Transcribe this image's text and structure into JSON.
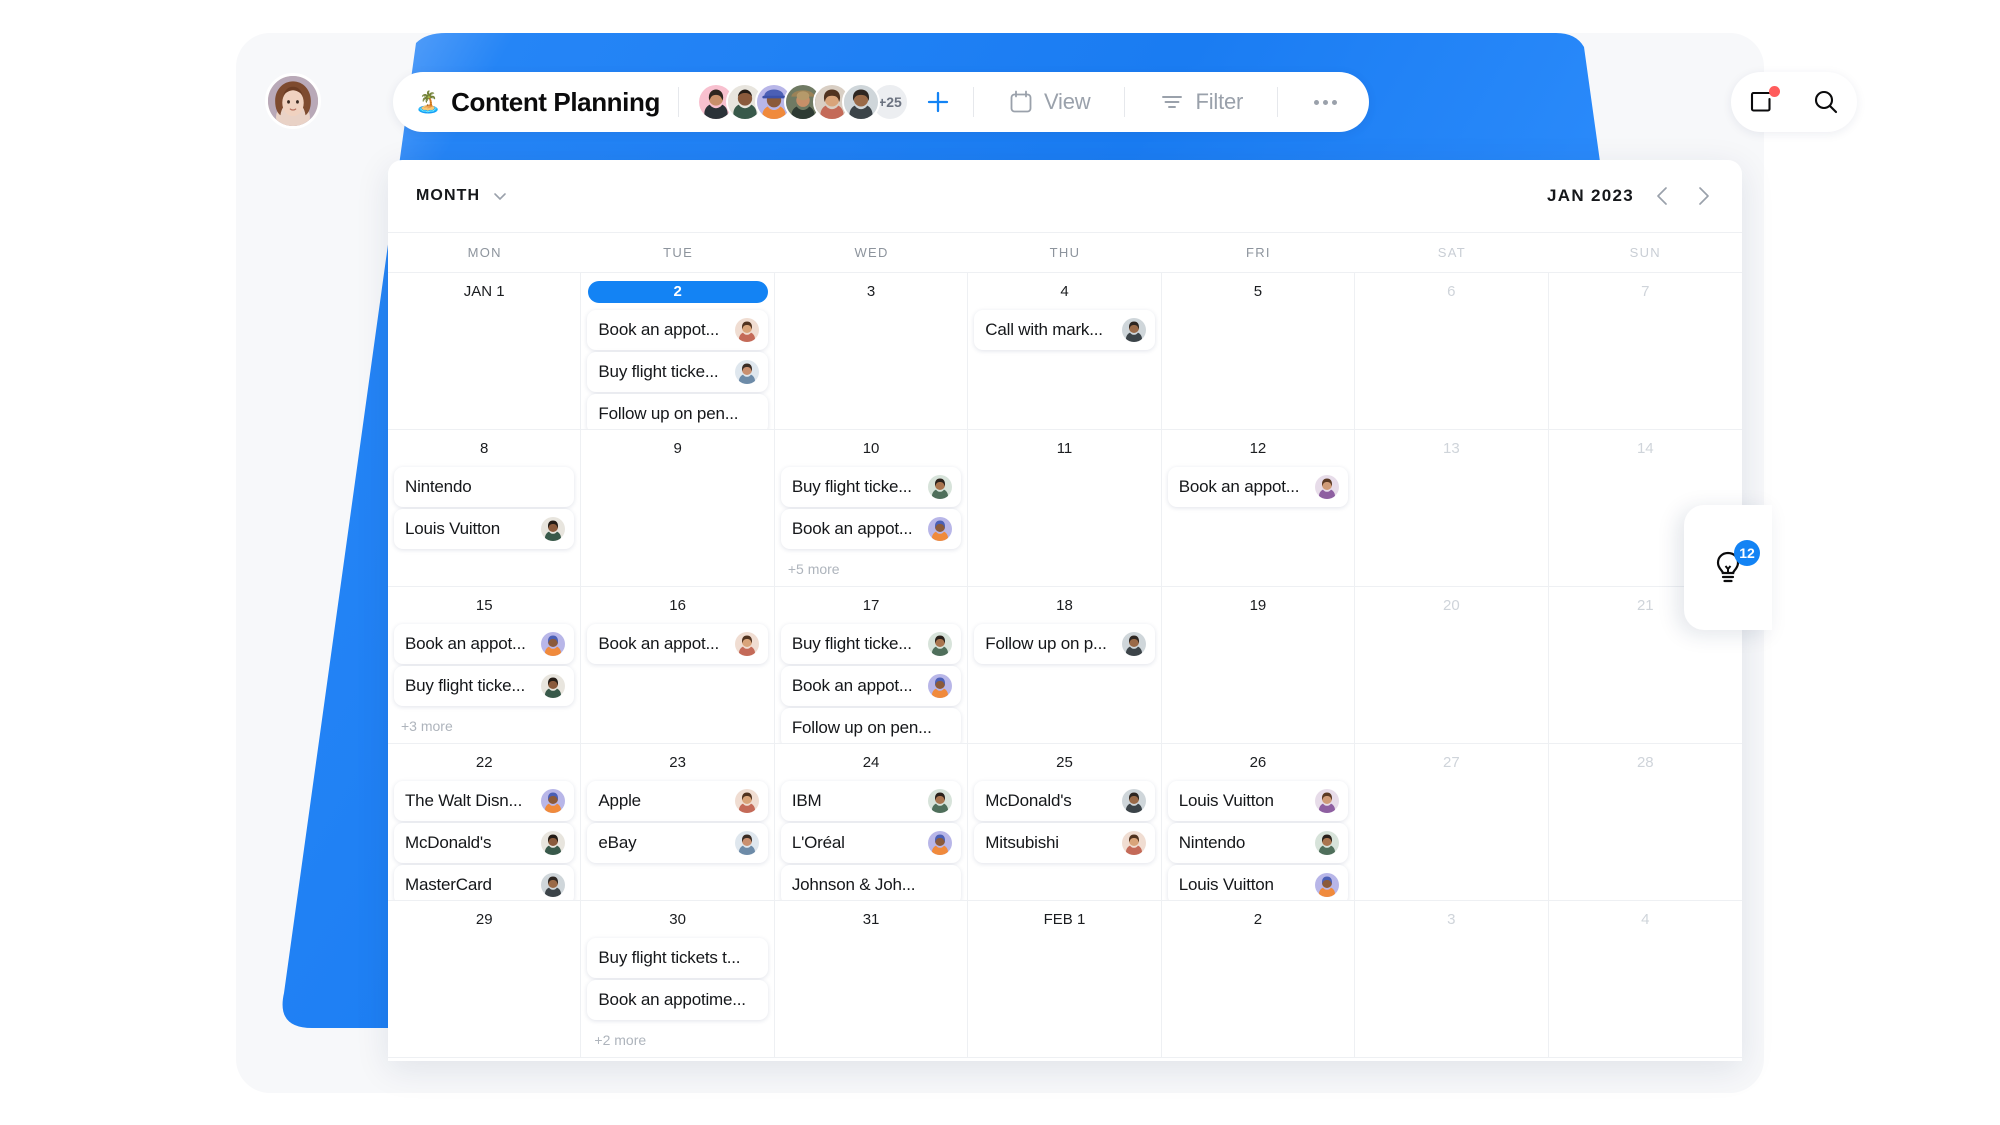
{
  "header": {
    "board_emoji": "🏝️",
    "board_title": "Content Planning",
    "members_overflow": "+25",
    "add_member_icon": "plus-icon",
    "view_label": "View",
    "filter_label": "Filter",
    "more_label": "...",
    "notifications_icon": "inbox-icon",
    "search_icon": "search-icon",
    "accent_color": "#1383f4",
    "notification_dot_color": "#ff5c5c"
  },
  "calendar": {
    "view_mode": "MONTH",
    "view_chevron_icon": "chevron-down-icon",
    "period": "JAN 2023",
    "prev_icon": "chevron-left-icon",
    "next_icon": "chevron-right-icon",
    "weekdays": [
      {
        "label": "MON",
        "dim": false
      },
      {
        "label": "TUE",
        "dim": false
      },
      {
        "label": "WED",
        "dim": false
      },
      {
        "label": "THU",
        "dim": false
      },
      {
        "label": "FRI",
        "dim": false
      },
      {
        "label": "SAT",
        "dim": true
      },
      {
        "label": "SUN",
        "dim": true
      }
    ],
    "days": [
      {
        "num": "JAN 1",
        "dim": false,
        "today": false,
        "events": [],
        "more": ""
      },
      {
        "num": "2",
        "dim": false,
        "today": true,
        "events": [
          {
            "title": "Book an appot...",
            "avatar": true
          },
          {
            "title": "Buy flight ticke...",
            "avatar": true
          },
          {
            "title": "Follow up on pen...",
            "avatar": false
          }
        ],
        "more": ""
      },
      {
        "num": "3",
        "dim": false,
        "today": false,
        "events": [],
        "more": ""
      },
      {
        "num": "4",
        "dim": false,
        "today": false,
        "events": [
          {
            "title": "Call with mark...",
            "avatar": true
          }
        ],
        "more": ""
      },
      {
        "num": "5",
        "dim": false,
        "today": false,
        "events": [],
        "more": ""
      },
      {
        "num": "6",
        "dim": true,
        "today": false,
        "events": [],
        "more": ""
      },
      {
        "num": "7",
        "dim": true,
        "today": false,
        "events": [],
        "more": ""
      },
      {
        "num": "8",
        "dim": false,
        "today": false,
        "events": [
          {
            "title": "Nintendo",
            "avatar": false
          },
          {
            "title": "Louis Vuitton",
            "avatar": true
          }
        ],
        "more": ""
      },
      {
        "num": "9",
        "dim": false,
        "today": false,
        "events": [],
        "more": ""
      },
      {
        "num": "10",
        "dim": false,
        "today": false,
        "events": [
          {
            "title": "Buy flight ticke...",
            "avatar": true
          },
          {
            "title": "Book an appot...",
            "avatar": true
          }
        ],
        "more": "+5 more"
      },
      {
        "num": "11",
        "dim": false,
        "today": false,
        "events": [],
        "more": ""
      },
      {
        "num": "12",
        "dim": false,
        "today": false,
        "events": [
          {
            "title": "Book an appot...",
            "avatar": true
          }
        ],
        "more": ""
      },
      {
        "num": "13",
        "dim": true,
        "today": false,
        "events": [],
        "more": ""
      },
      {
        "num": "14",
        "dim": true,
        "today": false,
        "events": [],
        "more": ""
      },
      {
        "num": "15",
        "dim": false,
        "today": false,
        "events": [
          {
            "title": "Book an appot...",
            "avatar": true
          },
          {
            "title": "Buy flight ticke...",
            "avatar": true
          }
        ],
        "more": "+3 more"
      },
      {
        "num": "16",
        "dim": false,
        "today": false,
        "events": [
          {
            "title": "Book an appot...",
            "avatar": true
          }
        ],
        "more": ""
      },
      {
        "num": "17",
        "dim": false,
        "today": false,
        "events": [
          {
            "title": "Buy flight ticke...",
            "avatar": true
          },
          {
            "title": "Book an appot...",
            "avatar": true
          },
          {
            "title": "Follow up on pen...",
            "avatar": false
          }
        ],
        "more": ""
      },
      {
        "num": "18",
        "dim": false,
        "today": false,
        "events": [
          {
            "title": "Follow up on p...",
            "avatar": true
          }
        ],
        "more": ""
      },
      {
        "num": "19",
        "dim": false,
        "today": false,
        "events": [],
        "more": ""
      },
      {
        "num": "20",
        "dim": true,
        "today": false,
        "events": [],
        "more": ""
      },
      {
        "num": "21",
        "dim": true,
        "today": false,
        "events": [],
        "more": ""
      },
      {
        "num": "22",
        "dim": false,
        "today": false,
        "events": [
          {
            "title": "The Walt Disn...",
            "avatar": true
          },
          {
            "title": "McDonald's",
            "avatar": true
          },
          {
            "title": "MasterCard",
            "avatar": true
          }
        ],
        "more": ""
      },
      {
        "num": "23",
        "dim": false,
        "today": false,
        "events": [
          {
            "title": "Apple",
            "avatar": true
          },
          {
            "title": "eBay",
            "avatar": true
          }
        ],
        "more": ""
      },
      {
        "num": "24",
        "dim": false,
        "today": false,
        "events": [
          {
            "title": "IBM",
            "avatar": true
          },
          {
            "title": "L'Oréal",
            "avatar": true
          },
          {
            "title": "Johnson & Joh...",
            "avatar": false
          }
        ],
        "more": ""
      },
      {
        "num": "25",
        "dim": false,
        "today": false,
        "events": [
          {
            "title": "McDonald's",
            "avatar": true
          },
          {
            "title": "Mitsubishi",
            "avatar": true
          }
        ],
        "more": ""
      },
      {
        "num": "26",
        "dim": false,
        "today": false,
        "events": [
          {
            "title": "Louis Vuitton",
            "avatar": true
          },
          {
            "title": "Nintendo",
            "avatar": true
          },
          {
            "title": "Louis Vuitton",
            "avatar": true
          }
        ],
        "more": ""
      },
      {
        "num": "27",
        "dim": true,
        "today": false,
        "events": [],
        "more": ""
      },
      {
        "num": "28",
        "dim": true,
        "today": false,
        "events": [],
        "more": ""
      },
      {
        "num": "29",
        "dim": false,
        "today": false,
        "events": [],
        "more": ""
      },
      {
        "num": "30",
        "dim": false,
        "today": false,
        "events": [
          {
            "title": "Buy flight tickets t...",
            "avatar": false
          },
          {
            "title": "Book an appotime...",
            "avatar": false
          }
        ],
        "more": "+2 more"
      },
      {
        "num": "31",
        "dim": false,
        "today": false,
        "events": [],
        "more": ""
      },
      {
        "num": "FEB 1",
        "dim": false,
        "today": false,
        "events": [],
        "more": ""
      },
      {
        "num": "2",
        "dim": false,
        "today": false,
        "events": [],
        "more": ""
      },
      {
        "num": "3",
        "dim": true,
        "today": false,
        "events": [],
        "more": ""
      },
      {
        "num": "4",
        "dim": true,
        "today": false,
        "events": [],
        "more": ""
      }
    ]
  },
  "tip_widget": {
    "icon": "lightbulb-icon",
    "badge_count": "12",
    "badge_color": "#1383f4"
  }
}
